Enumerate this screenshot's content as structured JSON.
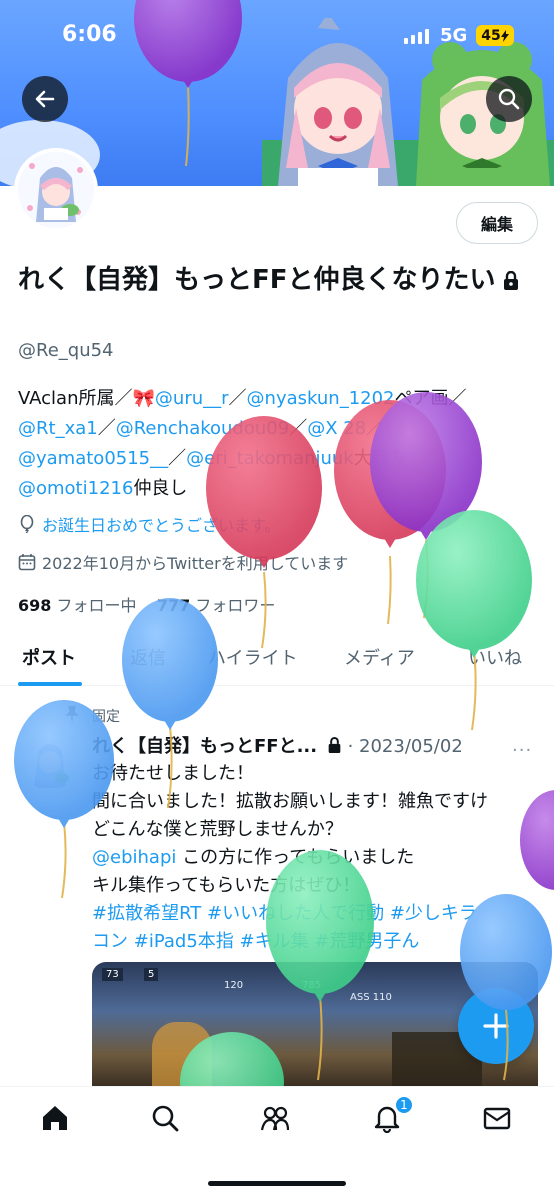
{
  "status_bar": {
    "time": "6:06",
    "network": "5G",
    "battery": "45"
  },
  "profile": {
    "edit_label": "編集",
    "name": "れく【自発】もっとFFと仲良くなりたい",
    "handle": "@Re_qu54",
    "bio": [
      [
        {
          "t": "VAclan所属／"
        },
        {
          "t": "🎀",
          "e": 1
        },
        {
          "t": "@uru__r",
          "l": 1
        },
        {
          "t": "／"
        },
        {
          "t": "@nyaskun_1202",
          "l": 1
        },
        {
          "t": "ペア画／"
        }
      ],
      [
        {
          "t": "@Rt_xa1",
          "l": 1
        },
        {
          "t": "／"
        },
        {
          "t": "@Renchakoudou09",
          "l": 1
        },
        {
          "t": "／"
        },
        {
          "t": "@X",
          "l": 1
        },
        {
          "t": "    "
        },
        {
          "t": "28",
          "l": 1
        },
        {
          "t": "／"
        },
        {
          "t": "📢",
          "e": 1
        }
      ],
      [
        {
          "t": "@yamato0515__",
          "l": 1
        },
        {
          "t": "／"
        },
        {
          "t": "@eri_takomanjuuk",
          "l": 1
        },
        {
          "t": "大親友"
        }
      ],
      [
        {
          "t": "@omoti1216",
          "l": 1
        },
        {
          "t": "仲良し"
        }
      ]
    ],
    "birthday": "お誕生日おめでとうございます。",
    "joined": "2022年10月からTwitterを利用しています",
    "following_count": "698",
    "following_label": "フォロー中",
    "followers_count": "777",
    "followers_label": "フォロワー"
  },
  "tabs": [
    "ポスト",
    "返信",
    "ハイライト",
    "メディア",
    "いいね"
  ],
  "post": {
    "pinned_label": "固定",
    "author": "れく【自発】もっとFFと...",
    "date": "· 2023/05/02",
    "more": "···",
    "lines": [
      [
        {
          "t": "お待たせしました！"
        }
      ],
      [
        {
          "t": "間に合いました！拡散お願いします！雑魚ですけ"
        }
      ],
      [
        {
          "t": "どこんな僕と荒野しませんか？"
        }
      ],
      [
        {
          "t": "@ebihapi",
          "l": 1
        },
        {
          "t": " この方に作ってもらいました"
        }
      ],
      [
        {
          "t": "キル集作ってもらいた方はぜひ！"
        }
      ],
      [
        {
          "t": "#拡散希望RT",
          "l": 1
        },
        {
          "t": " "
        },
        {
          "t": "#いいねした人で行動",
          "l": 1
        },
        {
          "t": " "
        },
        {
          "t": "#少しキラ",
          "l": 1
        }
      ],
      [
        {
          "t": "コン",
          "l": 1
        },
        {
          "t": " "
        },
        {
          "t": "#iPad5本指",
          "l": 1
        },
        {
          "t": " "
        },
        {
          "t": "#キル集",
          "l": 1
        },
        {
          "t": " "
        },
        {
          "t": "#荒野男子ん",
          "l": 1
        }
      ]
    ],
    "media_hud": [
      "73",
      "5",
      "120",
      "785",
      "ASS 110"
    ]
  },
  "notification_count": "1",
  "colors": {
    "accent": "#1d9bf0",
    "text": "#0f1419",
    "secondary": "#536471"
  },
  "icons": [
    "back-arrow-icon",
    "search-icon",
    "lock-icon",
    "balloon-icon",
    "calendar-icon",
    "pin-icon",
    "home-icon",
    "search-icon",
    "people-icon",
    "bell-icon",
    "mail-icon",
    "plus-icon"
  ]
}
